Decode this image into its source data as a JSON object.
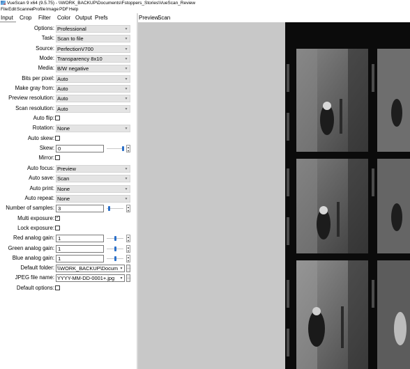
{
  "window": {
    "title": "VueScan 9 x64 (9.5.75) - \\\\WORK_BACKUP\\Documents\\Fstoppers_Stories\\VueScan_Review"
  },
  "menu": [
    "File",
    "Edit",
    "Scanner",
    "Profile",
    "Image",
    "PDF",
    "Help"
  ],
  "tabs": [
    "Input",
    "Crop",
    "Filter",
    "Color",
    "Output",
    "Prefs"
  ],
  "preview_tabs": [
    "Preview",
    "Scan"
  ],
  "settings": {
    "options": {
      "label": "Options:",
      "value": "Professional"
    },
    "task": {
      "label": "Task:",
      "value": "Scan to file"
    },
    "source": {
      "label": "Source:",
      "value": "PerfectionV700"
    },
    "mode": {
      "label": "Mode:",
      "value": "Transparency 8x10"
    },
    "media": {
      "label": "Media:",
      "value": "B/W negative"
    },
    "bits_per_pixel": {
      "label": "Bits per pixel:",
      "value": "Auto"
    },
    "make_gray_from": {
      "label": "Make gray from:",
      "value": "Auto"
    },
    "preview_resolution": {
      "label": "Preview resolution:",
      "value": "Auto"
    },
    "scan_resolution": {
      "label": "Scan resolution:",
      "value": "Auto"
    },
    "auto_flip": {
      "label": "Auto flip:"
    },
    "rotation": {
      "label": "Rotation:",
      "value": "None"
    },
    "auto_skew": {
      "label": "Auto skew:"
    },
    "skew": {
      "label": "Skew:",
      "value": "0"
    },
    "mirror": {
      "label": "Mirror:"
    },
    "auto_focus": {
      "label": "Auto focus:",
      "value": "Preview"
    },
    "auto_save": {
      "label": "Auto save:",
      "value": "Scan"
    },
    "auto_print": {
      "label": "Auto print:",
      "value": "None"
    },
    "auto_repeat": {
      "label": "Auto repeat:",
      "value": "None"
    },
    "number_of_samples": {
      "label": "Number of samples:",
      "value": "3"
    },
    "multi_exposure": {
      "label": "Multi exposure:",
      "checked": true
    },
    "lock_exposure": {
      "label": "Lock exposure:"
    },
    "red_analog_gain": {
      "label": "Red analog gain:",
      "value": "1"
    },
    "green_analog_gain": {
      "label": "Green analog gain:",
      "value": "1"
    },
    "blue_analog_gain": {
      "label": "Blue analog gain:",
      "value": "1"
    },
    "default_folder": {
      "label": "Default folder:",
      "value": "\\\\WORK_BACKUP\\Documents"
    },
    "jpeg_file_name": {
      "label": "JPEG file name:",
      "value": "YYYY-MM-DD-0001+.jpg"
    },
    "default_options": {
      "label": "Default options:"
    }
  },
  "icons": {
    "dropdown": "▾",
    "spin_up": "▲",
    "spin_down": "▼",
    "check": "✓",
    "browse": "…"
  }
}
